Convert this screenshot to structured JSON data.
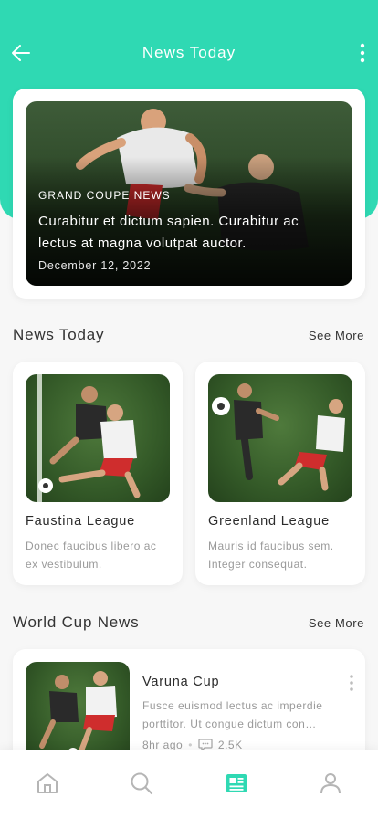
{
  "header": {
    "title": "News Today",
    "back_icon": "arrow-left-icon",
    "menu_icon": "more-vertical-icon",
    "accent_color": "#2fd9b3"
  },
  "featured": {
    "category": "GRAND COUPE NEWS",
    "title": "Curabitur et dictum sapien. Curabitur ac lectus at magna volutpat auctor.",
    "date": "December 12, 2022"
  },
  "news_today": {
    "section_title": "News Today",
    "see_more": "See More",
    "cards": [
      {
        "name": "Faustina League",
        "description": "Donec faucibus libero ac ex vestibulum."
      },
      {
        "name": "Greenland League",
        "description": "Mauris id faucibus sem. Integer consequat."
      }
    ]
  },
  "world_cup": {
    "section_title": "World Cup News",
    "see_more": "See More",
    "items": [
      {
        "name": "Varuna Cup",
        "description": "Fusce euismod lectus ac imperdie porttitor. Ut congue dictum con…",
        "time": "8hr ago",
        "comments": "2.5K"
      }
    ]
  },
  "bottom_nav": {
    "items": [
      {
        "icon": "home-icon",
        "active": false
      },
      {
        "icon": "search-icon",
        "active": false
      },
      {
        "icon": "newspaper-icon",
        "active": true
      },
      {
        "icon": "profile-icon",
        "active": false
      }
    ],
    "active_color": "#2fd9b3",
    "inactive_color": "#b5b5b5"
  }
}
